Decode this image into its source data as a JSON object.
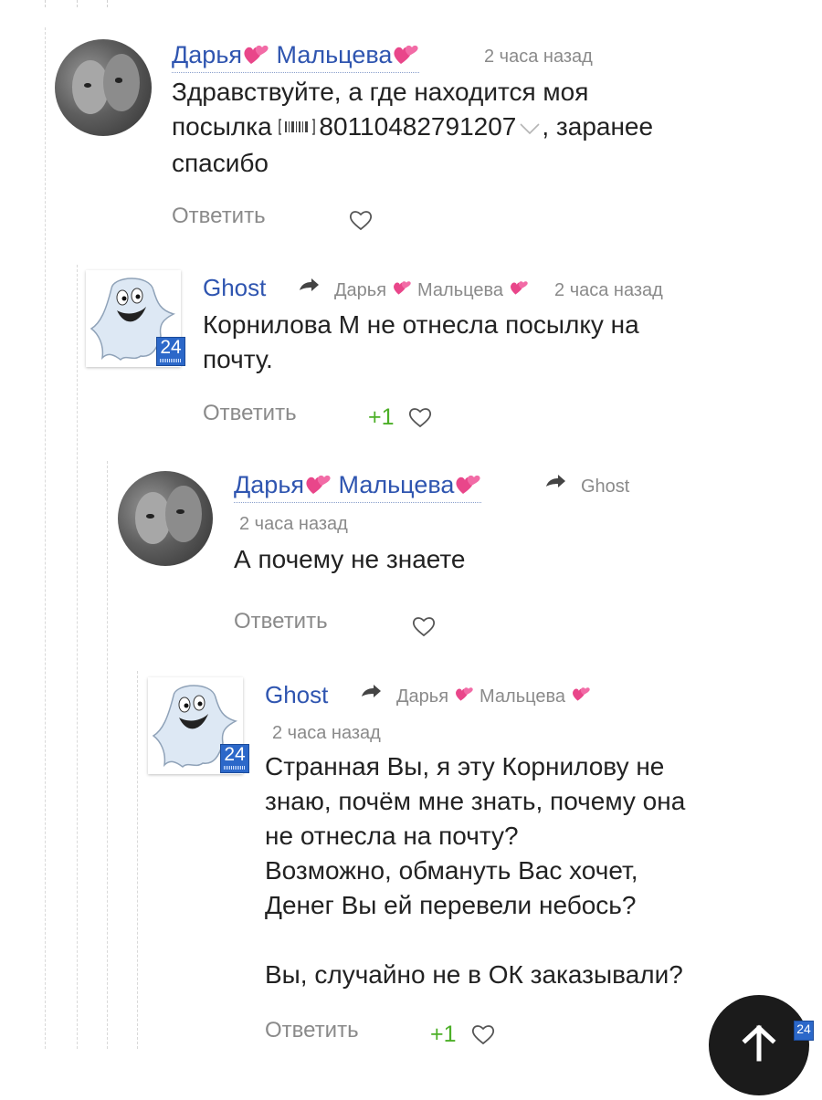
{
  "comments": [
    {
      "author": "Дарья",
      "author_last": "Мальцева",
      "time": "2 часа назад",
      "text_before": "Здравствуйте, а где находится моя",
      "text_line2_pre": "посылка",
      "tracking": "80110482791207",
      "text_line2_post": ", заранее",
      "text_line3": "спасибо",
      "reply_label": "Ответить"
    },
    {
      "author": "Ghost",
      "reply_to_first": "Дарья",
      "reply_to_last": "Мальцева",
      "time": "2 часа назад",
      "text_line1": "Корнилова М не отнесла посылку на",
      "text_line2": "почту.",
      "badge": "24",
      "reply_label": "Ответить",
      "likes": "+1"
    },
    {
      "author": "Дарья",
      "author_last": "Мальцева",
      "reply_to": "Ghost",
      "time": "2 часа назад",
      "text_line1": "А почему не знаете",
      "reply_label": "Ответить"
    },
    {
      "author": "Ghost",
      "reply_to_first": "Дарья",
      "reply_to_last": "Мальцева",
      "time": "2 часа назад",
      "badge": "24",
      "lines": [
        "Странная Вы, я эту Корнилову не",
        "знаю, почём мне знать, почему она",
        "не отнесла на почту?",
        "Возможно, обмануть Вас хочет,",
        "Денег Вы ей перевели небось?",
        "",
        "Вы, случайно не в ОК заказывали?"
      ],
      "reply_label": "Ответить",
      "likes": "+1"
    }
  ],
  "corner_badge": "24",
  "icons": [
    "heart-emoji",
    "heart-outline-icon",
    "reply-arrow-icon",
    "barcode-icon",
    "chevron-down-icon",
    "arrow-up-icon",
    "badge-24-icon"
  ],
  "colors": {
    "author": "#2f55b0",
    "muted": "#8a8a8a",
    "likes": "#4caf27",
    "badge": "#2c68c9"
  }
}
